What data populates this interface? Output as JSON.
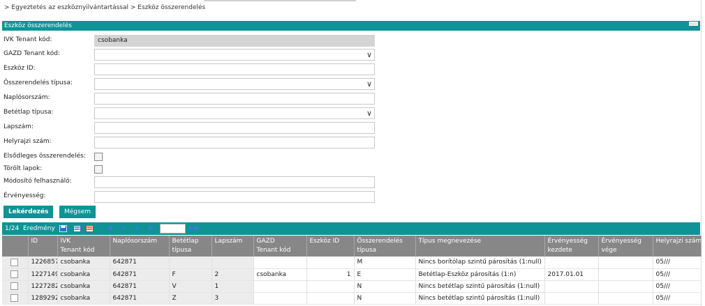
{
  "breadcrumb": "> Egyeztetés az eszköznyilvántartással > Eszköz összerendelés",
  "panel": {
    "title": "Eszköz összerendelés"
  },
  "form": {
    "ivk_tenant": {
      "label": "IVK Tenant kód:",
      "value": "csobanka"
    },
    "gazd_tenant": {
      "label": "GAZD Tenant kód:",
      "value": ""
    },
    "eszkoz_id": {
      "label": "Eszköz ID:",
      "value": ""
    },
    "osszerendeles_tipusa": {
      "label": "Összerendelés típusa:",
      "value": ""
    },
    "naplosorszam": {
      "label": "Naplósorszám:",
      "value": ""
    },
    "betetlap_tipusa": {
      "label": "Betétlap típusa:",
      "value": ""
    },
    "lapszam": {
      "label": "Lapszám:",
      "value": ""
    },
    "helyrajzi_szam": {
      "label": "Helyrajzi szám:",
      "value": ""
    },
    "elsodleges": {
      "label": "Elsődleges összerendelés:"
    },
    "torolt_lapok": {
      "label": "Törölt lapok:"
    },
    "modosito": {
      "label": "Módosító felhasználó:",
      "value": ""
    },
    "ervenyesseg": {
      "label": "Érvényesség:",
      "value": ""
    }
  },
  "buttons": {
    "query": "Lekérdezés",
    "cancel": "Mégsem"
  },
  "toolbar": {
    "page": "1/24",
    "results": "Eredmény"
  },
  "colors": {
    "accent": "#0f9396",
    "header_bg": "#878787"
  },
  "table": {
    "columns": [
      {
        "l1": "",
        "l2": ""
      },
      {
        "l1": "ID",
        "l2": ""
      },
      {
        "l1": "IVK",
        "l2": "Tenant kód"
      },
      {
        "l1": "Naplósorszám",
        "l2": ""
      },
      {
        "l1": "Betétlap",
        "l2": "típusa"
      },
      {
        "l1": "Lapszám",
        "l2": ""
      },
      {
        "l1": "GAZD",
        "l2": "Tenant kód"
      },
      {
        "l1": "Eszköz ID",
        "l2": ""
      },
      {
        "l1": "Összerendelés",
        "l2": "típusa"
      },
      {
        "l1": "Típus megnevezése",
        "l2": ""
      },
      {
        "l1": "Érvényesség",
        "l2": "kezdete"
      },
      {
        "l1": "Érvényesség",
        "l2": "vége"
      },
      {
        "l1": "Helyrajzi szám",
        "l2": ""
      }
    ],
    "rows": [
      {
        "id": "1226857",
        "ivk": "csobanka",
        "naplo": "642871",
        "betetlap": "",
        "lapszam": "",
        "gazd": "",
        "eszkoz": "",
        "tipus": "M",
        "megnevezes": "Nincs borítólap szintű párosítás (1:null)",
        "kezdet": "",
        "veg": "",
        "hrsz": "05///"
      },
      {
        "id": "1227149",
        "ivk": "csobanka",
        "naplo": "642871",
        "betetlap": "F",
        "lapszam": "2",
        "gazd": "csobanka",
        "eszkoz": "1",
        "tipus": "E",
        "megnevezes": "Betétlap-Eszköz párosítás (1:n)",
        "kezdet": "2017.01.01",
        "veg": "",
        "hrsz": "05///"
      },
      {
        "id": "1227282",
        "ivk": "csobanka",
        "naplo": "642871",
        "betetlap": "V",
        "lapszam": "1",
        "gazd": "",
        "eszkoz": "",
        "tipus": "N",
        "megnevezes": "Nincs betétlap szintű párosítás (1:null)",
        "kezdet": "",
        "veg": "",
        "hrsz": "05///"
      },
      {
        "id": "1289292",
        "ivk": "csobanka",
        "naplo": "642871",
        "betetlap": "Z",
        "lapszam": "3",
        "gazd": "",
        "eszkoz": "",
        "tipus": "N",
        "megnevezes": "Nincs betétlap szintű párosítás (1:null)",
        "kezdet": "",
        "veg": "",
        "hrsz": "05///"
      }
    ]
  }
}
